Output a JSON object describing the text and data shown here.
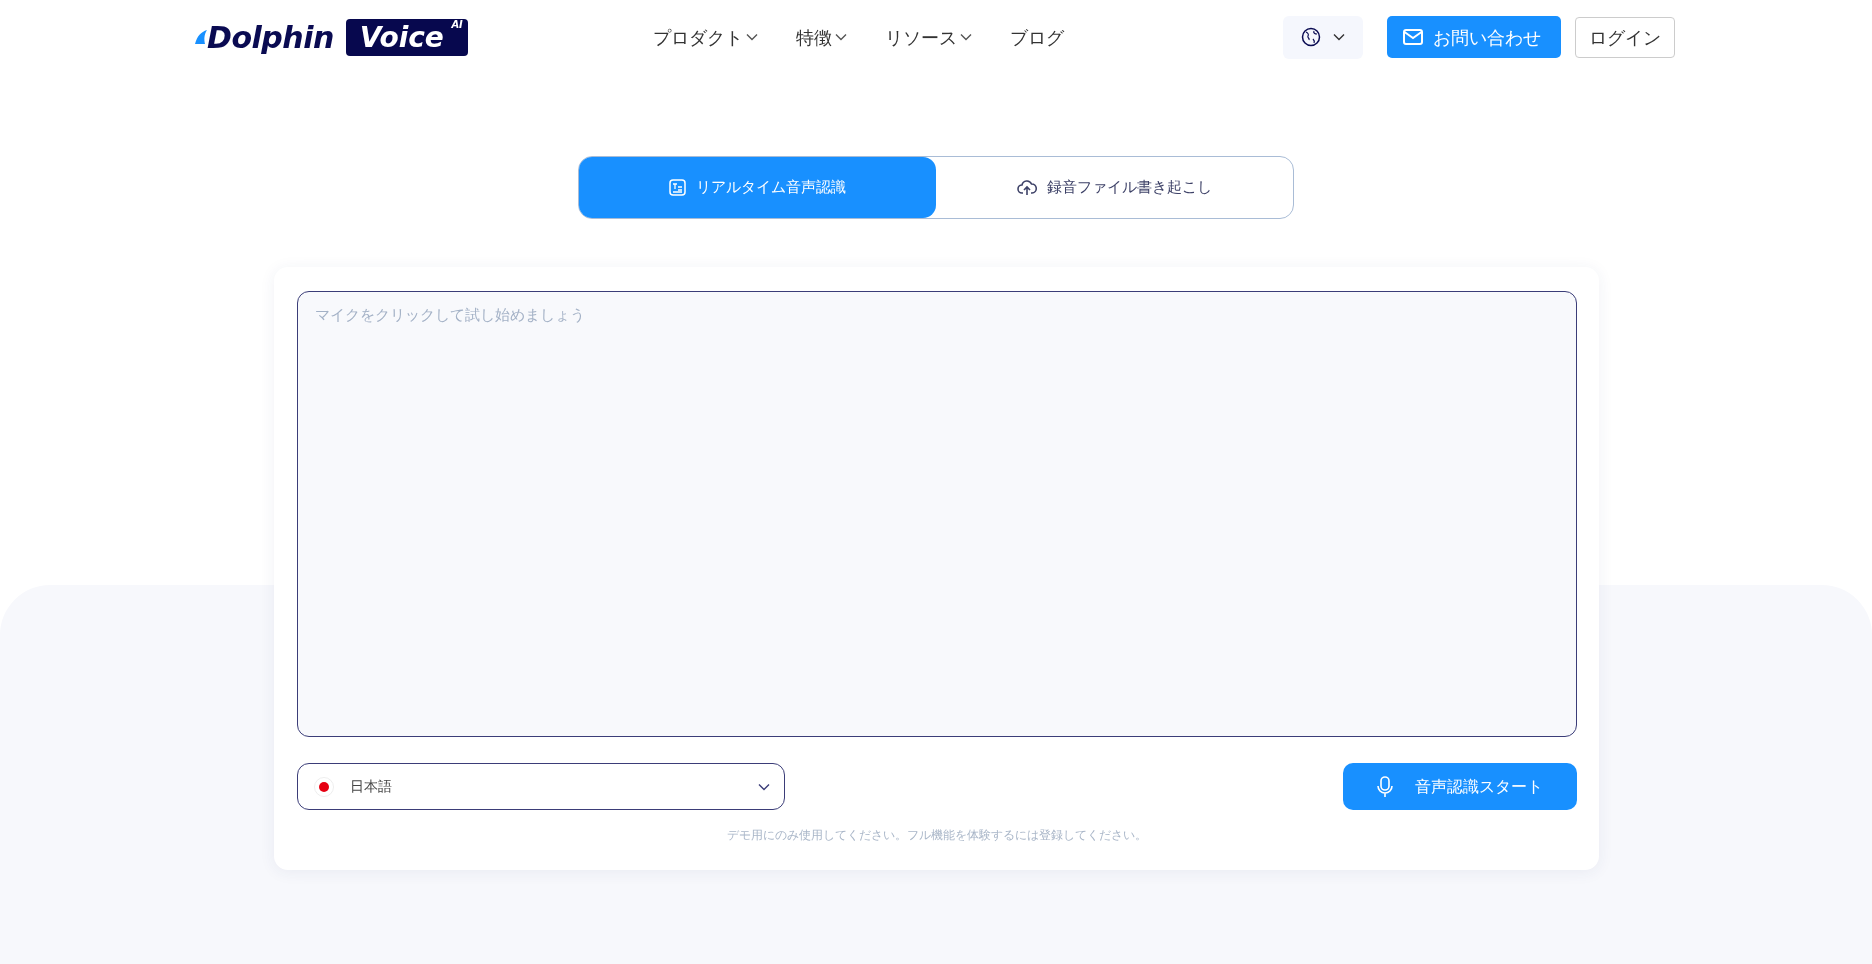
{
  "header": {
    "logo": {
      "name": "Dolphin",
      "badge": "Voice",
      "badge_sup": "AI"
    },
    "nav": [
      {
        "label": "プロダクト",
        "dropdown": true
      },
      {
        "label": "特徴",
        "dropdown": true
      },
      {
        "label": "リソース",
        "dropdown": true
      },
      {
        "label": "ブログ",
        "dropdown": false
      }
    ],
    "contact_button": "お問い合わせ",
    "login_button": "ログイン"
  },
  "mode_tabs": [
    {
      "label": "リアルタイム音声認識",
      "kind": "text",
      "selected": true
    },
    {
      "label": "録音ファイル書き起こし",
      "kind": "upload",
      "selected": false
    }
  ],
  "transcript": {
    "placeholder": "マイクをクリックして試し始めましょう"
  },
  "language_select": {
    "value": "日本語"
  },
  "start_button": "音声認識スタート",
  "note": "デモ用にのみ使用してください。フル機能を体験するには登録してください。"
}
